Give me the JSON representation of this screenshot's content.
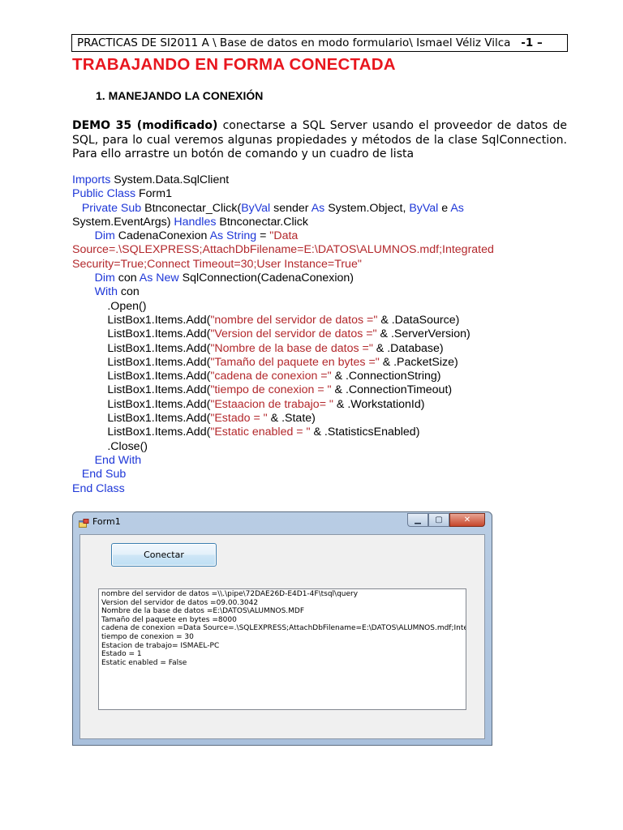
{
  "header": {
    "text": "PRACTICAS DE SI2011 A \\ Base de datos en modo formulario\\ Ismael  Véliz Vilca",
    "page": "-1 –"
  },
  "title": "TRABAJANDO EN FORMA CONECTADA",
  "section": "1. MANEJANDO LA CONEXIÓN",
  "intro": {
    "demo": "DEMO 35 (modificado)",
    "text": " conectarse a SQL Server usando el proveedor de datos de SQL, para lo cual  veremos algunas propiedades y métodos  de la clase SqlConnection. Para ello arrastre un botón de comando y un cuadro de lista"
  },
  "code_lines": [
    [
      {
        "t": "Imports",
        "c": "kw"
      },
      {
        "t": " System.Data.SqlClient"
      }
    ],
    [
      {
        "t": "Public Class",
        "c": "kw"
      },
      {
        "t": " Form1"
      }
    ],
    [
      {
        "t": "   "
      },
      {
        "t": "Private Sub",
        "c": "kw"
      },
      {
        "t": " Btnconectar_Click("
      },
      {
        "t": "ByVal",
        "c": "kw"
      },
      {
        "t": " sender "
      },
      {
        "t": "As",
        "c": "kw"
      },
      {
        "t": " System.Object, "
      },
      {
        "t": "ByVal",
        "c": "kw"
      },
      {
        "t": " e "
      },
      {
        "t": "As",
        "c": "kw"
      }
    ],
    [
      {
        "t": "System.EventArgs) "
      },
      {
        "t": "Handles",
        "c": "kw"
      },
      {
        "t": " Btnconectar.Click"
      }
    ],
    [
      {
        "t": "       "
      },
      {
        "t": "Dim",
        "c": "kw"
      },
      {
        "t": " CadenaConexion "
      },
      {
        "t": "As String",
        "c": "kw"
      },
      {
        "t": " = "
      },
      {
        "t": "\"Data",
        "c": "str"
      }
    ],
    [
      {
        "t": "Source=.\\SQLEXPRESS;AttachDbFilename=E:\\DATOS\\ALUMNOS.mdf;Integrated",
        "c": "str"
      }
    ],
    [
      {
        "t": "Security=True;Connect Timeout=30;User Instance=True\"",
        "c": "str"
      }
    ],
    [
      {
        "t": "       "
      },
      {
        "t": "Dim",
        "c": "kw"
      },
      {
        "t": " con "
      },
      {
        "t": "As New",
        "c": "kw"
      },
      {
        "t": " SqlConnection(CadenaConexion)"
      }
    ],
    [
      {
        "t": "       "
      },
      {
        "t": "With",
        "c": "kw"
      },
      {
        "t": " con"
      }
    ],
    [
      {
        "t": "           .Open()"
      }
    ],
    [
      {
        "t": "           ListBox1.Items.Add("
      },
      {
        "t": "\"nombre del servidor de datos =\"",
        "c": "str"
      },
      {
        "t": " & .DataSource)"
      }
    ],
    [
      {
        "t": "           ListBox1.Items.Add("
      },
      {
        "t": "\"Version del servidor de datos =\"",
        "c": "str"
      },
      {
        "t": " & .ServerVersion)"
      }
    ],
    [
      {
        "t": "           ListBox1.Items.Add("
      },
      {
        "t": "\"Nombre de la base de datos =\"",
        "c": "str"
      },
      {
        "t": " & .Database)"
      }
    ],
    [
      {
        "t": "           ListBox1.Items.Add("
      },
      {
        "t": "\"Tamaño del paquete en bytes =\"",
        "c": "str"
      },
      {
        "t": " & .PacketSize)"
      }
    ],
    [
      {
        "t": "           ListBox1.Items.Add("
      },
      {
        "t": "\"cadena de conexion =\"",
        "c": "str"
      },
      {
        "t": " & .ConnectionString)"
      }
    ],
    [
      {
        "t": "           ListBox1.Items.Add("
      },
      {
        "t": "\"tiempo de conexion = \"",
        "c": "str"
      },
      {
        "t": " & .ConnectionTimeout)"
      }
    ],
    [
      {
        "t": "           ListBox1.Items.Add("
      },
      {
        "t": "\"Estaacion de trabajo= \"",
        "c": "str"
      },
      {
        "t": " & .WorkstationId)"
      }
    ],
    [
      {
        "t": "           ListBox1.Items.Add("
      },
      {
        "t": "\"Estado = \"",
        "c": "str"
      },
      {
        "t": " & .State)"
      }
    ],
    [
      {
        "t": "           ListBox1.Items.Add("
      },
      {
        "t": "\"Estatic enabled = \"",
        "c": "str"
      },
      {
        "t": " & .StatisticsEnabled)"
      }
    ],
    [
      {
        "t": "           .Close()"
      }
    ],
    [
      {
        "t": "       "
      },
      {
        "t": "End With",
        "c": "kw"
      }
    ],
    [
      {
        "t": "   "
      },
      {
        "t": "End Sub",
        "c": "kw"
      }
    ],
    [
      {
        "t": "End Class",
        "c": "kw"
      }
    ]
  ],
  "window": {
    "title": "Form1",
    "icon": "form-app-icon",
    "controls": {
      "minimize": "▁",
      "maximize": "▢",
      "close": "✕"
    },
    "button_label": "Conectar",
    "list_items": [
      "nombre del servidor de datos =\\\\.\\pipe\\72DAE26D-E4D1-4F\\tsql\\query",
      "Version del servidor de datos =09.00.3042",
      "Nombre de la base de datos =E:\\DATOS\\ALUMNOS.MDF",
      "Tamaño del paquete en bytes =8000",
      "cadena de conexion =Data Source=.\\SQLEXPRESS;AttachDbFilename=E:\\DATOS\\ALUMNOS.mdf;Integra",
      "tiempo de conexion = 30",
      "Estacion de trabajo= ISMAEL-PC",
      "Estado = 1",
      "Estatic enabled = False"
    ]
  },
  "colors": {
    "title": "#e8161e",
    "keyword": "#1e37d8",
    "string": "#b3282c"
  }
}
